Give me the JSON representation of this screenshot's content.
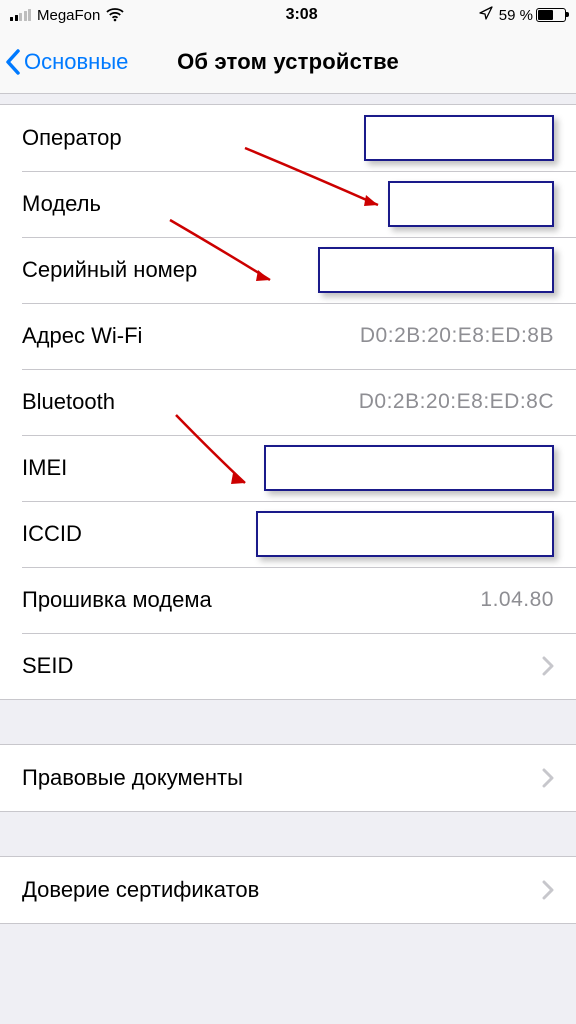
{
  "statusBar": {
    "carrier": "MegaFon",
    "time": "3:08",
    "batteryPct": "59 %"
  },
  "nav": {
    "back": "Основные",
    "title": "Об этом устройстве"
  },
  "rows": {
    "operator": "Оператор",
    "model": "Модель",
    "serial": "Серийный номер",
    "wifiLabel": "Адрес Wi-Fi",
    "wifiValue": "D0:2B:20:E8:ED:8B",
    "btLabel": "Bluetooth",
    "btValue": "D0:2B:20:E8:ED:8C",
    "imei": "IMEI",
    "iccid": "ICCID",
    "firmwareLabel": "Прошивка модема",
    "firmwareValue": "1.04.80",
    "seid": "SEID",
    "legal": "Правовые документы",
    "trust": "Доверие сертификатов"
  }
}
